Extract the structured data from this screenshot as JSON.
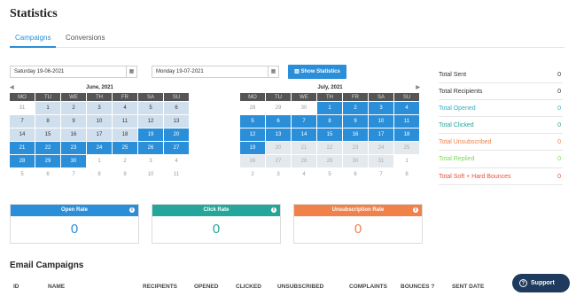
{
  "page": {
    "title": "Statistics"
  },
  "tabs": [
    {
      "label": "Campaigns",
      "active": true
    },
    {
      "label": "Conversions",
      "active": false
    }
  ],
  "date_range": {
    "start": "Saturday 19-06-2021",
    "end": "Monday 19-07-2021",
    "calendar_icon": "calendar-icon",
    "show_button": "Show Statistics",
    "show_button_icon": "bar-chart-icon"
  },
  "calendars": [
    {
      "month": "June, 2021",
      "weekdays": [
        "MO",
        "TU",
        "WE",
        "TH",
        "FR",
        "SA",
        "SU"
      ],
      "days": [
        {
          "d": "31",
          "s": "other"
        },
        {
          "d": "1",
          "s": "in"
        },
        {
          "d": "2",
          "s": "in"
        },
        {
          "d": "3",
          "s": "in"
        },
        {
          "d": "4",
          "s": "in"
        },
        {
          "d": "5",
          "s": "in"
        },
        {
          "d": "6",
          "s": "in"
        },
        {
          "d": "7",
          "s": "in"
        },
        {
          "d": "8",
          "s": "in"
        },
        {
          "d": "9",
          "s": "in"
        },
        {
          "d": "10",
          "s": "in"
        },
        {
          "d": "11",
          "s": "in"
        },
        {
          "d": "12",
          "s": "in"
        },
        {
          "d": "13",
          "s": "in"
        },
        {
          "d": "14",
          "s": "in"
        },
        {
          "d": "15",
          "s": "in"
        },
        {
          "d": "16",
          "s": "in"
        },
        {
          "d": "17",
          "s": "in"
        },
        {
          "d": "18",
          "s": "in"
        },
        {
          "d": "19",
          "s": "sel"
        },
        {
          "d": "20",
          "s": "sel"
        },
        {
          "d": "21",
          "s": "sel"
        },
        {
          "d": "22",
          "s": "sel"
        },
        {
          "d": "23",
          "s": "sel"
        },
        {
          "d": "24",
          "s": "sel"
        },
        {
          "d": "25",
          "s": "sel"
        },
        {
          "d": "26",
          "s": "sel"
        },
        {
          "d": "27",
          "s": "sel"
        },
        {
          "d": "28",
          "s": "sel"
        },
        {
          "d": "29",
          "s": "sel"
        },
        {
          "d": "30",
          "s": "sel"
        },
        {
          "d": "1",
          "s": "other"
        },
        {
          "d": "2",
          "s": "other"
        },
        {
          "d": "3",
          "s": "other"
        },
        {
          "d": "4",
          "s": "other"
        },
        {
          "d": "5",
          "s": "other"
        },
        {
          "d": "6",
          "s": "other"
        },
        {
          "d": "7",
          "s": "other"
        },
        {
          "d": "8",
          "s": "other"
        },
        {
          "d": "9",
          "s": "other"
        },
        {
          "d": "10",
          "s": "other"
        },
        {
          "d": "11",
          "s": "other"
        }
      ]
    },
    {
      "month": "July, 2021",
      "weekdays": [
        "MO",
        "TU",
        "WE",
        "TH",
        "FR",
        "SA",
        "SU"
      ],
      "days": [
        {
          "d": "28",
          "s": "other"
        },
        {
          "d": "29",
          "s": "other"
        },
        {
          "d": "30",
          "s": "other"
        },
        {
          "d": "1",
          "s": "sel"
        },
        {
          "d": "2",
          "s": "sel"
        },
        {
          "d": "3",
          "s": "sel"
        },
        {
          "d": "4",
          "s": "sel"
        },
        {
          "d": "5",
          "s": "sel"
        },
        {
          "d": "6",
          "s": "sel"
        },
        {
          "d": "7",
          "s": "sel"
        },
        {
          "d": "8",
          "s": "sel"
        },
        {
          "d": "9",
          "s": "sel"
        },
        {
          "d": "10",
          "s": "sel"
        },
        {
          "d": "11",
          "s": "sel"
        },
        {
          "d": "12",
          "s": "sel"
        },
        {
          "d": "13",
          "s": "sel"
        },
        {
          "d": "14",
          "s": "sel"
        },
        {
          "d": "15",
          "s": "sel"
        },
        {
          "d": "16",
          "s": "sel"
        },
        {
          "d": "17",
          "s": "sel"
        },
        {
          "d": "18",
          "s": "sel"
        },
        {
          "d": "19",
          "s": "sel"
        },
        {
          "d": "20",
          "s": "dis"
        },
        {
          "d": "21",
          "s": "dis"
        },
        {
          "d": "22",
          "s": "dis"
        },
        {
          "d": "23",
          "s": "dis"
        },
        {
          "d": "24",
          "s": "dis"
        },
        {
          "d": "25",
          "s": "dis"
        },
        {
          "d": "26",
          "s": "dis"
        },
        {
          "d": "27",
          "s": "dis"
        },
        {
          "d": "28",
          "s": "dis"
        },
        {
          "d": "29",
          "s": "dis"
        },
        {
          "d": "30",
          "s": "dis"
        },
        {
          "d": "31",
          "s": "dis"
        },
        {
          "d": "1",
          "s": "other"
        },
        {
          "d": "2",
          "s": "other"
        },
        {
          "d": "3",
          "s": "other"
        },
        {
          "d": "4",
          "s": "other"
        },
        {
          "d": "5",
          "s": "other"
        },
        {
          "d": "6",
          "s": "other"
        },
        {
          "d": "7",
          "s": "other"
        },
        {
          "d": "8",
          "s": "other"
        }
      ]
    }
  ],
  "stats": [
    {
      "label": "Total Sent",
      "value": "0",
      "color": "#333333"
    },
    {
      "label": "Total Recipients",
      "value": "0",
      "color": "#333333"
    },
    {
      "label": "Total Opened",
      "value": "0",
      "color": "#2eb0c9"
    },
    {
      "label": "Total Clicked",
      "value": "0",
      "color": "#26a69a"
    },
    {
      "label": "Total Unsubscribed",
      "value": "0",
      "color": "#f0814a"
    },
    {
      "label": "Total Replied",
      "value": "0",
      "color": "#7ed957"
    },
    {
      "label": "Total Soft + Hard Bounces",
      "value": "0",
      "color": "#e8503a"
    }
  ],
  "rate_cards": [
    {
      "label": "Open Rate",
      "value": "0",
      "color": "#2b8ed8"
    },
    {
      "label": "Click Rate",
      "value": "0",
      "color": "#26a69a"
    },
    {
      "label": "Unsubscription Rate",
      "value": "0",
      "color": "#f0814a"
    }
  ],
  "campaigns": {
    "title": "Email Campaigns",
    "columns": [
      "ID",
      "NAME",
      "RECIPIENTS",
      "OPENED",
      "CLICKED",
      "UNSUBSCRIBED",
      "COMPLAINTS",
      "BOUNCES",
      "SENT DATE"
    ],
    "bounces_help_icon": "question-circle-icon"
  },
  "support": {
    "label": "Support",
    "icon": "help-circle-icon"
  }
}
